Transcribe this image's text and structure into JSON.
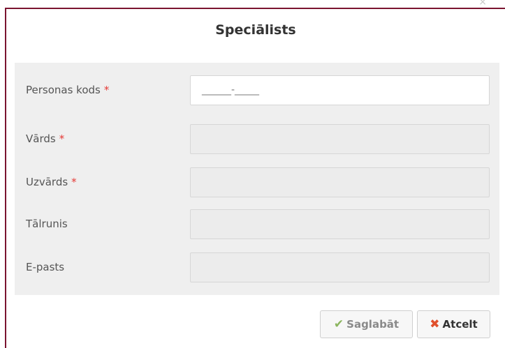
{
  "dialog": {
    "close_icon": "close-icon",
    "title": "Speciālists"
  },
  "form": {
    "fields": [
      {
        "label": "Personas kods",
        "required": "*",
        "mask": "______-_____"
      },
      {
        "label": "Vārds",
        "required": "*"
      },
      {
        "label": "Uzvārds",
        "required": "*"
      },
      {
        "label": "Tālrunis"
      },
      {
        "label": "E-pasts"
      }
    ]
  },
  "buttons": {
    "save": {
      "icon": "check-icon",
      "label": "Saglabāt"
    },
    "cancel": {
      "icon": "x-icon",
      "label": "Atcelt"
    }
  },
  "colors": {
    "modal_border": "#7a1430",
    "required": "#e53935",
    "save_check": "#8bb55e",
    "cancel_x": "#e0502c"
  }
}
